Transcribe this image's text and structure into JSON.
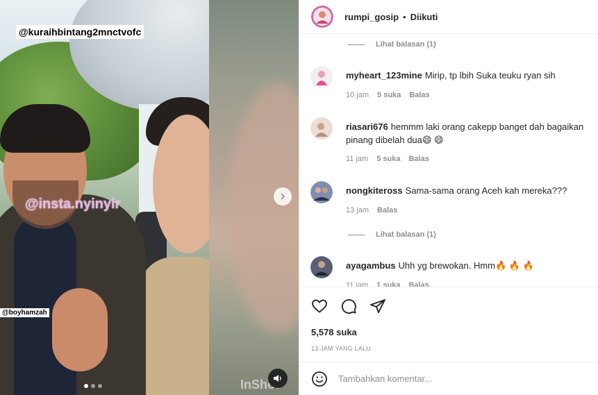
{
  "media": {
    "tag_top": "@kuraihbintang2mnctvofc",
    "watermark": "@insta.nyinyir",
    "tag_side": "@boyhamzah",
    "inshot_mark": "InShot",
    "carousel": {
      "count": 3,
      "active": 1
    }
  },
  "header": {
    "username": "rumpi_gosip",
    "separator": "•",
    "follow_status": "Diikuti"
  },
  "comments": {
    "view_replies_1": "Lihat balasan (1)",
    "view_replies_2": "Lihat balasan (1)",
    "items": [
      {
        "username": "myheart_123mine",
        "text": "Mirip, tp lbih Suka teuku ryan sih",
        "time": "10 jam",
        "likes": "5 suka",
        "reply": "Balas"
      },
      {
        "username": "riasari676",
        "text": "hemmm laki orang cakepp banget dah bagaikan pinang dibelah dua😄 😄",
        "time": "11 jam",
        "likes": "5 suka",
        "reply": "Balas"
      },
      {
        "username": "nongkiteross",
        "text": "Sama-sama orang Aceh kah mereka???",
        "time": "13 jam",
        "reply": "Balas"
      },
      {
        "username": "ayagambus",
        "text": "Uhh yg brewokan. Hmm🔥 🔥 🔥",
        "time": "11 jam",
        "likes": "1 suka",
        "reply": "Balas"
      }
    ]
  },
  "actions": {
    "likes": "5,578 suka",
    "time_ago": "13 JAM YANG LALU"
  },
  "composer": {
    "placeholder": "Tambahkan komentar..."
  },
  "icons": [
    "heart-icon",
    "comment-icon",
    "share-icon",
    "emoji-icon",
    "chevron-right-icon",
    "speaker-icon"
  ]
}
